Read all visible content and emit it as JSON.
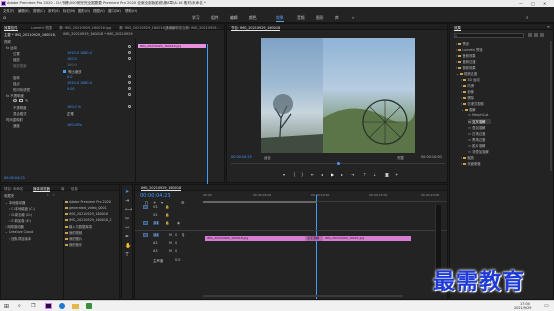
{
  "window": {
    "title": "Adobe Premiere Pro 2020 - D:\\书籍\\500例完完全图要要 Premiere Pro 2020 全案全部版影频\\第8章\\8-16 素材\\未命名 *",
    "controls": [
      "—",
      "□",
      "✕"
    ]
  },
  "menu": [
    "文件(F)",
    "编辑(E)",
    "剪辑(C)",
    "序列(S)",
    "标记(M)",
    "图形(G)",
    "视图(V)",
    "窗口(W)",
    "帮助(H)"
  ],
  "workspaces": [
    "学习",
    "组件",
    "编辑",
    "颜色",
    "效果",
    "音频",
    "图形",
    "库"
  ],
  "active_workspace": "效果",
  "effect_controls": {
    "tabs": [
      "效果控件",
      "Lumetri 范围",
      "源: IMG_20210929_160018.jpg",
      "源: IMG_20210929_160018_1.jpg",
      "音频剪辑混合器: IMG_20210929..."
    ],
    "source": "主要 * IMG_20210929_160018.jpg",
    "sequence": "IMG_20210929_160018 * IMG_20210929...",
    "clip_label": "IMG_20210929_160018.jpg",
    "rows": [
      {
        "label": "视频",
        "value": ""
      },
      {
        "label": "fx  运动",
        "value": ""
      },
      {
        "label": "位置",
        "value": "1920.0    1080.0"
      },
      {
        "label": "缩放",
        "value": "100.0"
      },
      {
        "label": "缩放宽度",
        "value": "100.0"
      },
      {
        "label": "",
        "value": "等比缩放"
      },
      {
        "label": "旋转",
        "value": "0.0"
      },
      {
        "label": "锚点",
        "value": "1920.0    1080.0"
      },
      {
        "label": "防闪烁滤镜",
        "value": "0.00"
      },
      {
        "label": "fx  不透明度",
        "value": ""
      },
      {
        "label": "不透明度",
        "value": "100.0 %"
      },
      {
        "label": "混合模式",
        "value": "正常"
      },
      {
        "label": "时间重映射",
        "value": ""
      },
      {
        "label": "速度",
        "value": "100.00%"
      }
    ],
    "timecode": "00:00:04:23"
  },
  "program_monitor": {
    "title": "节目: IMG_20210929_160018",
    "timecode_left": "00:00:04:23",
    "fit": "适合",
    "quality": "完整",
    "timecode_right": "00:00:10:00"
  },
  "project": {
    "tabs": [
      "项目: 未命名",
      "媒体浏览器",
      "库",
      "信息"
    ],
    "breadcrumb": "收藏夹",
    "tree": [
      "本地驱动器",
      "C:本地磁盘 (C:)",
      "D:新加卷 (D:)",
      "E:新加卷 (E:)",
      "网络驱动器",
      "Creative Cloud",
      "团队项目版本"
    ],
    "files": [
      {
        "name": "Adobe Premiere Pro 2020",
        "type": "文件夹"
      },
      {
        "name": "generated_video_0001",
        "type": "文件夹"
      },
      {
        "name": "IMG_20210929_160018",
        "type": "文件夹"
      },
      {
        "name": "IMG_20210929_160018_1",
        "type": "文件夹"
      },
      {
        "name": "输入与数据库录",
        "type": "文件夹"
      },
      {
        "name": "我的视频",
        "type": "文件夹"
      },
      {
        "name": "我的图片",
        "type": "文件夹"
      },
      {
        "name": "我的音乐",
        "type": "文件夹"
      }
    ]
  },
  "timeline": {
    "tab": "IMG_20210929_160018",
    "timecode": "00:00:04:23",
    "ruler": [
      "00:00",
      "00:00:05:00",
      "00:00:10:00",
      "00:00:15:00",
      "00:00:20:00"
    ],
    "tracks": [
      "V3",
      "V2",
      "V1",
      "A1",
      "A2",
      "A3",
      "主声道"
    ],
    "master_value": "0.0",
    "clips": [
      {
        "label": "IMG_20210929_160018.jpg"
      },
      {
        "label": "交叉溶解"
      },
      {
        "label": "IMG_20210929_16001.jpg"
      }
    ]
  },
  "effects": {
    "title": "效果",
    "tree": [
      "预设",
      "Lumetri 预设",
      "音频效果",
      "音频过渡",
      "视频效果",
      "视频过渡",
      "3D 运动",
      "内滑",
      "划像",
      "擦除",
      "沉浸式视频",
      "溶解",
      "MorphCut",
      "交叉溶解",
      "叠加溶解",
      "白场过渡",
      "黑场过渡",
      "胶片溶解",
      "非叠加溶解",
      "缩放",
      "页面剥落"
    ],
    "selected": "交叉溶解"
  },
  "taskbar": {
    "time": "17:04",
    "date": "2021/9/29"
  },
  "watermark": "最需教育"
}
